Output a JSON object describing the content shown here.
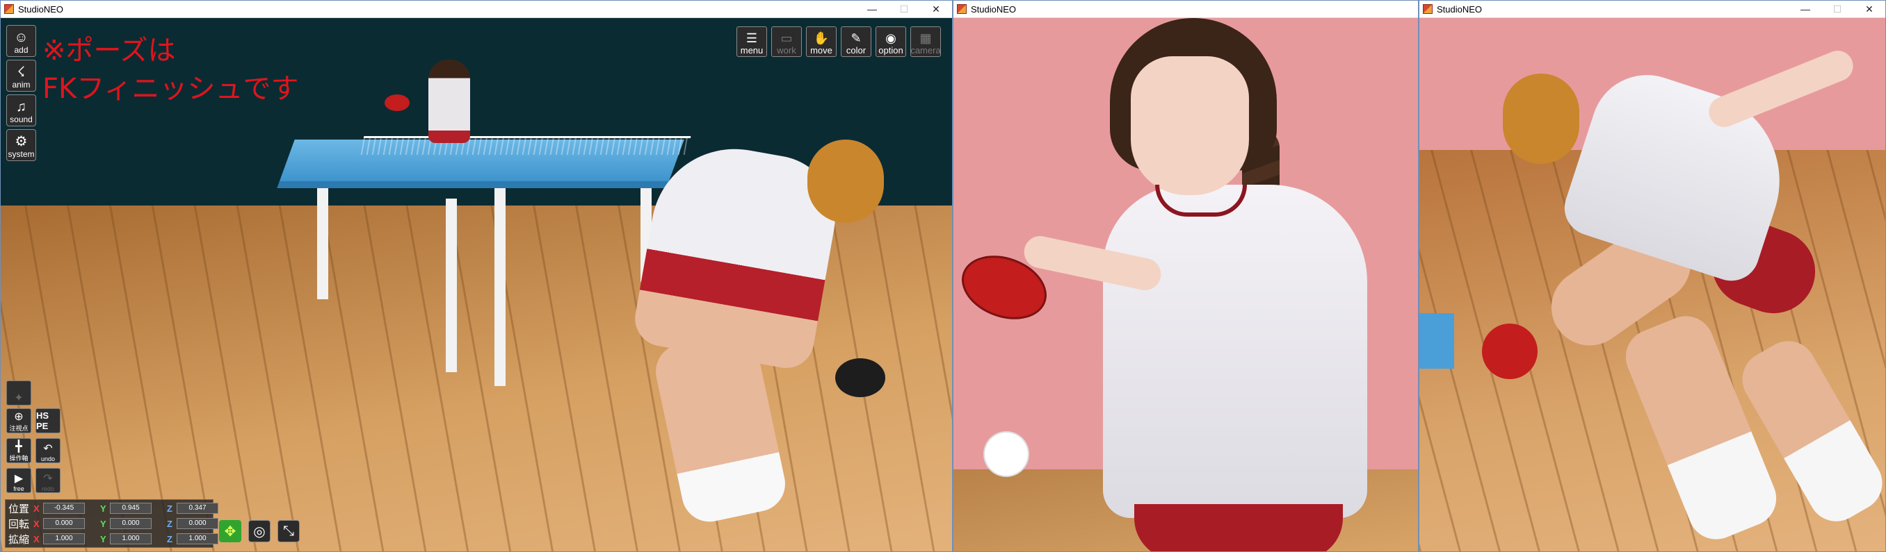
{
  "windows": [
    {
      "title": "StudioNEO"
    },
    {
      "title": "StudioNEO"
    },
    {
      "title": "StudioNEO"
    }
  ],
  "window_controls": {
    "minimize": "—",
    "maximize": "☐",
    "close": "✕"
  },
  "overlay_text": {
    "line1": "※ポーズは",
    "line2": "FKフィニッシュです"
  },
  "left_menu": [
    {
      "label": "add",
      "icon": "person-icon"
    },
    {
      "label": "anim",
      "icon": "run-icon"
    },
    {
      "label": "sound",
      "icon": "music-icon"
    },
    {
      "label": "system",
      "icon": "gears-icon"
    }
  ],
  "top_menu": [
    {
      "label": "menu",
      "icon": "list-icon",
      "enabled": true
    },
    {
      "label": "work",
      "icon": "work-icon",
      "enabled": false
    },
    {
      "label": "move",
      "icon": "hand-icon",
      "enabled": true
    },
    {
      "label": "color",
      "icon": "palette-icon",
      "enabled": true
    },
    {
      "label": "option",
      "icon": "eye-icon",
      "enabled": true
    },
    {
      "label": "camera",
      "icon": "film-icon",
      "enabled": false
    }
  ],
  "small_buttons": {
    "center_label": "注視点",
    "hspe_label": "HS PE",
    "axis_label": "操作軸",
    "undo_label": "undo",
    "free_label": "free",
    "redo_label": "redo"
  },
  "transform": {
    "position_label": "位置",
    "rotation_label": "回転",
    "scale_label": "拡縮",
    "axis_x": "X",
    "axis_y": "Y",
    "axis_z": "Z",
    "position": {
      "x": "-0.345",
      "y": "0.945",
      "z": "0.347"
    },
    "rotation": {
      "x": "0.000",
      "y": "0.000",
      "z": "0.000"
    },
    "scale": {
      "x": "1.000",
      "y": "1.000",
      "z": "1.000"
    }
  },
  "colors": {
    "pose_text": "#e0141c",
    "axis_x": "#ff3b3b",
    "axis_y": "#5de05d",
    "axis_z": "#6ab0ff"
  }
}
